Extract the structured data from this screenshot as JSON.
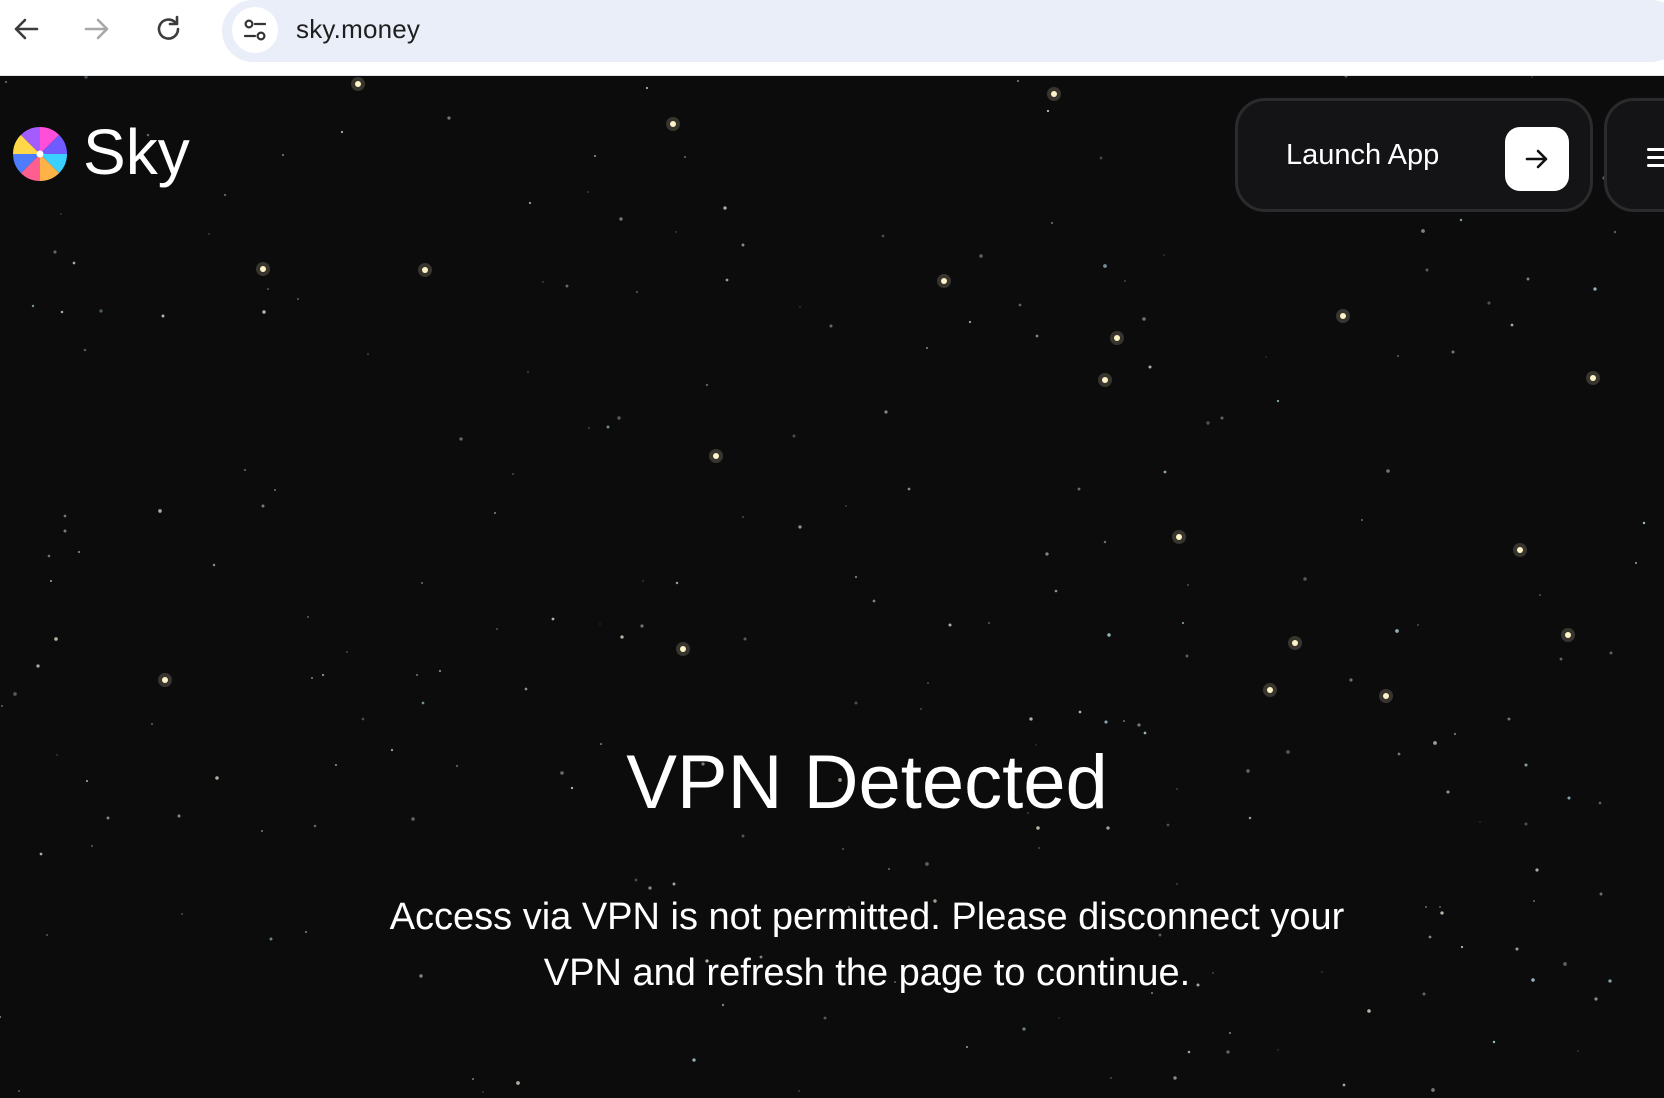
{
  "browser": {
    "url": "sky.money",
    "icons": {
      "back": "arrow-left-icon",
      "forward": "arrow-right-icon",
      "reload": "reload-icon",
      "site_info": "tune-icon"
    }
  },
  "header": {
    "logo_text": "Sky",
    "launch_button_label": "Launch App",
    "launch_icon": "arrow-right-icon",
    "menu_icon": "hamburger-menu-icon"
  },
  "main": {
    "title": "VPN Detected",
    "message": "Access via VPN is not permitted. Please disconnect your VPN and refresh the page to continue."
  },
  "colors": {
    "background": "#0c0c0d",
    "text": "#ffffff",
    "button_background": "#141416",
    "button_border": "#2b2b2e",
    "omnibox": "#e9eef8",
    "star": "#fff3c8"
  }
}
